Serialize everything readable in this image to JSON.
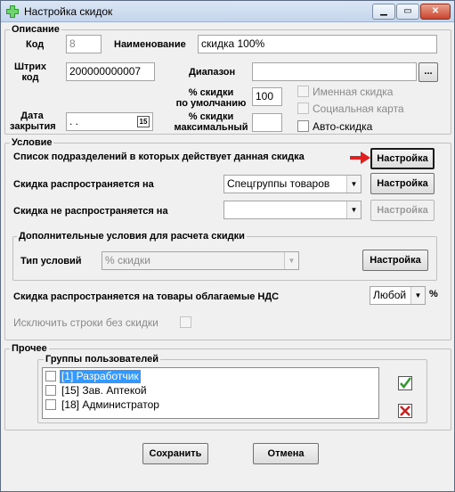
{
  "window": {
    "title": "Настройка скидок"
  },
  "description": {
    "legend": "Описание",
    "code_label": "Код",
    "code_value": "8",
    "name_label": "Наименование",
    "name_value": "скидка 100%",
    "barcode_label_1": "Штрих",
    "barcode_label_2": "код",
    "barcode_value": "200000000007",
    "range_label": "Диапазон",
    "range_value": "",
    "range_button": "...",
    "default_pct_label_1": "% скидки",
    "default_pct_label_2": "по умолчанию",
    "default_pct_value": "100",
    "max_pct_label_1": "% скидки",
    "max_pct_label_2": "максимальный",
    "max_pct_value": "",
    "close_date_label_1": "Дата",
    "close_date_label_2": "закрытия",
    "close_date_value": " .  .",
    "calendar_icon_text": "15",
    "named_discount": "Именная скидка",
    "social_card": "Социальная карта",
    "auto_discount": "Авто-скидка"
  },
  "condition": {
    "legend": "Условие",
    "departments_label": "Список подразделений в которых действует данная скидка",
    "departments_button": "Настройка",
    "applies_label": "Скидка распространяется на",
    "applies_value": "Спецгруппы товаров",
    "applies_button": "Настройка",
    "not_applies_label": "Скидка не распространяется на",
    "not_applies_value": "",
    "not_applies_button": "Настройка",
    "extra_legend": "Дополнительные условия для расчета  скидки",
    "condition_type_label": "Тип условий",
    "condition_type_value": "% скидки",
    "condition_type_button": "Настройка",
    "vat_label": "Скидка распространяется  на товары облагаемые НДС",
    "vat_value": "Любой",
    "vat_suffix": "%",
    "exclude_label": "Исключить строки без скидки"
  },
  "other": {
    "legend": "Прочее",
    "user_groups_legend": "Группы пользователей",
    "user_groups": [
      {
        "label": "[1] Разработчик",
        "checked": false,
        "selected": true
      },
      {
        "label": "[15] Зав. Аптекой",
        "checked": false,
        "selected": false
      },
      {
        "label": "[18] Администратор",
        "checked": false,
        "selected": false
      }
    ]
  },
  "footer": {
    "save_label": "Сохранить",
    "cancel_label": "Отмена"
  },
  "colors": {
    "selection": "#3399ff",
    "pointer_arrow": "#e01f1f",
    "check_green": "#2e9a2e",
    "cross_red": "#c82020"
  }
}
